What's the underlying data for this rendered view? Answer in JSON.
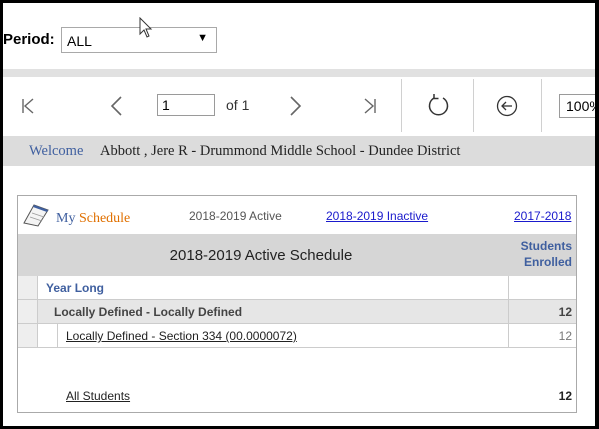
{
  "filter": {
    "period_label": "Period:",
    "period_value": "ALL"
  },
  "toolbar": {
    "page_value": "1",
    "of_text": "of 1",
    "zoom_value": "100%"
  },
  "welcome": {
    "label": "Welcome",
    "user_text": "Abbott , Jere R - Drummond Middle School - Dundee District"
  },
  "tabs": {
    "my": "My",
    "schedule": "Schedule",
    "active": "2018-2019 Active",
    "inactive": "2018-2019 Inactive",
    "prior": "2017-2018"
  },
  "schedule": {
    "title": "2018-2019 Active Schedule",
    "students_header_line1": "Students",
    "students_header_line2": "Enrolled",
    "group_label": "Year Long",
    "course_label": "Locally Defined - Locally Defined",
    "course_count": "12",
    "section_label": "Locally Defined - Section 334 (00.0000072)",
    "section_count": "12",
    "all_students_label": "All Students",
    "all_students_count": "12"
  },
  "colors": {
    "link_blue": "#3f5f9f",
    "schedule_orange": "#e07000"
  }
}
